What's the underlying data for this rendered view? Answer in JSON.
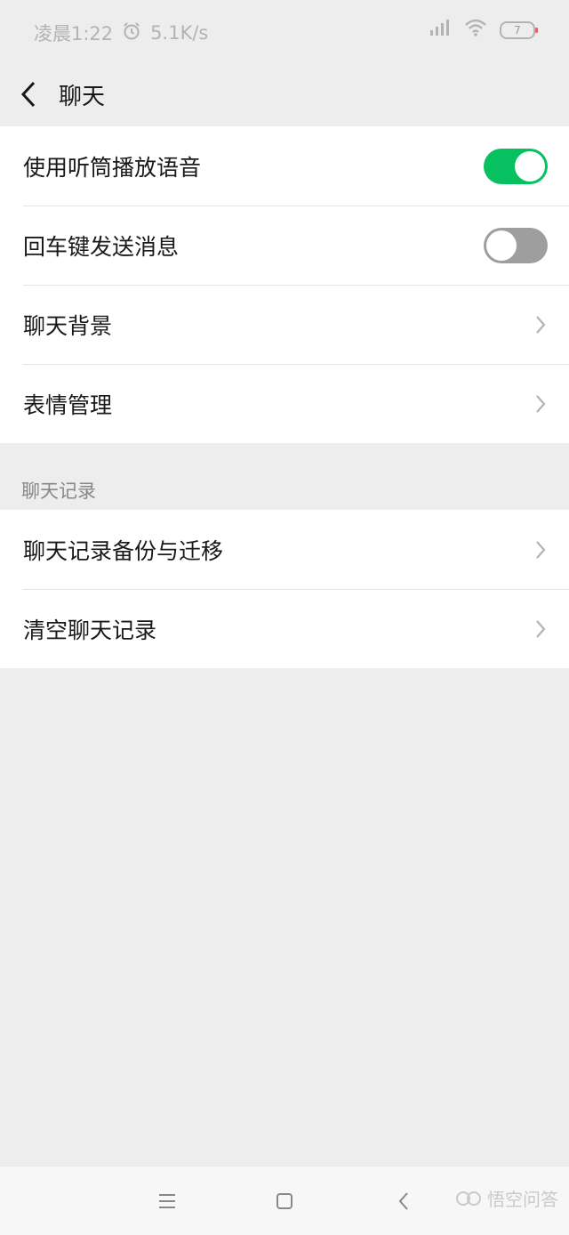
{
  "status_bar": {
    "time": "凌晨1:22",
    "speed": "5.1K/s",
    "battery": "7"
  },
  "header": {
    "title": "聊天"
  },
  "settings": {
    "items": [
      {
        "label": "使用听筒播放语音",
        "toggle": true
      },
      {
        "label": "回车键发送消息",
        "toggle": false
      },
      {
        "label": "聊天背景"
      },
      {
        "label": "表情管理"
      }
    ]
  },
  "chat_history": {
    "section_label": "聊天记录",
    "items": [
      {
        "label": "聊天记录备份与迁移"
      },
      {
        "label": "清空聊天记录"
      }
    ]
  },
  "watermark": {
    "text": "悟空问答"
  },
  "colors": {
    "toggle_on": "#07c160",
    "toggle_off": "#9e9e9e",
    "background": "#ededed"
  }
}
